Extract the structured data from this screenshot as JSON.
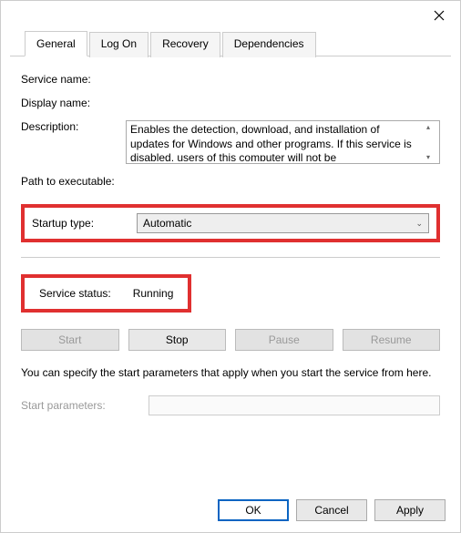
{
  "tabs": {
    "general": "General",
    "logon": "Log On",
    "recovery": "Recovery",
    "dependencies": "Dependencies"
  },
  "labels": {
    "service_name": "Service name:",
    "display_name": "Display name:",
    "description": "Description:",
    "path": "Path to executable:",
    "startup_type": "Startup type:",
    "service_status": "Service status:",
    "start_parameters": "Start parameters:"
  },
  "values": {
    "description_text": "Enables the detection, download, and installation of updates for Windows and other programs. If this service is disabled, users of this computer will not be",
    "startup_type": "Automatic",
    "service_status": "Running"
  },
  "buttons": {
    "start": "Start",
    "stop": "Stop",
    "pause": "Pause",
    "resume": "Resume",
    "ok": "OK",
    "cancel": "Cancel",
    "apply": "Apply"
  },
  "hint": "You can specify the start parameters that apply when you start the service from here."
}
